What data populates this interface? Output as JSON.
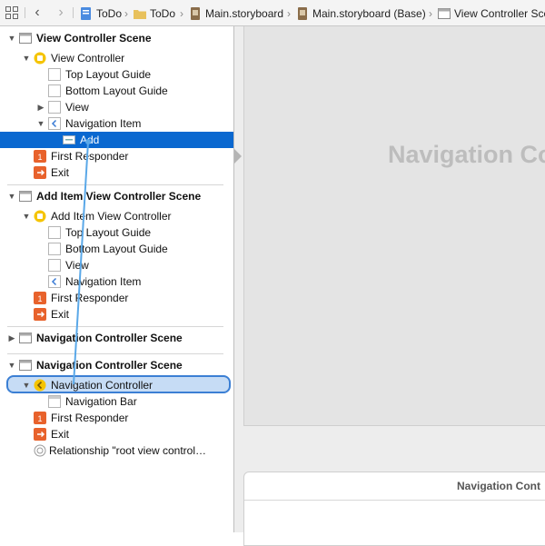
{
  "jumpbar": {
    "grid_icon": "grid-icon",
    "back_icon": "chevron-left-icon",
    "forward_icon": "chevron-right-icon",
    "crumbs": [
      {
        "label": "ToDo",
        "icon": "project-icon"
      },
      {
        "label": "ToDo",
        "icon": "folder-icon"
      },
      {
        "label": "Main.storyboard",
        "icon": "storyboard-icon"
      },
      {
        "label": "Main.storyboard (Base)",
        "icon": "storyboard-icon"
      },
      {
        "label": "View Controller Scene",
        "icon": "scene-icon"
      }
    ]
  },
  "outline": {
    "scene1": {
      "title": "View Controller Scene",
      "vc": "View Controller",
      "top_guide": "Top Layout Guide",
      "bottom_guide": "Bottom Layout Guide",
      "view": "View",
      "nav_item": "Navigation Item",
      "add": "Add",
      "first_responder": "First Responder",
      "exit": "Exit"
    },
    "scene2": {
      "title": "Add Item View Controller Scene",
      "vc": "Add Item View Controller",
      "top_guide": "Top Layout Guide",
      "bottom_guide": "Bottom Layout Guide",
      "view": "View",
      "nav_item": "Navigation Item",
      "first_responder": "First Responder",
      "exit": "Exit"
    },
    "scene3": {
      "title": "Navigation Controller Scene"
    },
    "scene4": {
      "title": "Navigation Controller Scene",
      "nav_controller": "Navigation Controller",
      "nav_bar": "Navigation Bar",
      "first_responder": "First Responder",
      "exit": "Exit",
      "relationship": "Relationship \"root view control…"
    }
  },
  "canvas": {
    "scene_title": "Navigation Co",
    "bottom_scene_title": "Navigation Cont"
  },
  "colors": {
    "selection": "#0a68d0",
    "drag_line": "#5aa8e8",
    "vc_yellow": "#f5c400",
    "responder_orange": "#e8622c"
  }
}
